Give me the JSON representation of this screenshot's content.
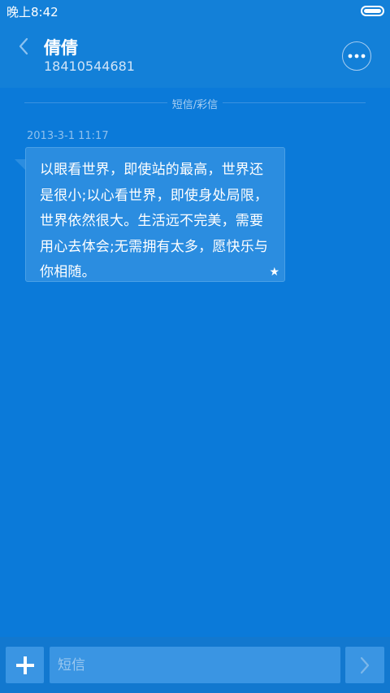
{
  "status_bar": {
    "time": "晚上8:42"
  },
  "header": {
    "contact_name": "倩倩",
    "contact_number": "18410544681"
  },
  "thread": {
    "type_label": "短信/彩信",
    "messages": [
      {
        "timestamp": "2013-3-1 11:17",
        "text": "以眼看世界，即使站的最高，世界还是很小;以心看世界，即使身处局限，世界依然很大。生活远不完美，需要用心去体会;无需拥有太多，愿快乐与你相随。",
        "starred": true
      }
    ]
  },
  "composer": {
    "placeholder": "短信"
  }
}
